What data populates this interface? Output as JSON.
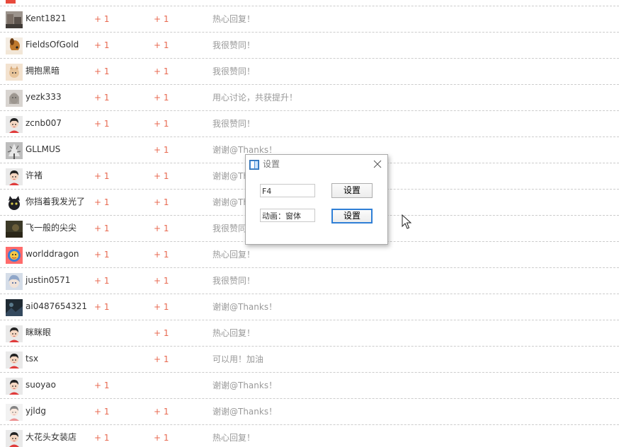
{
  "rows": [
    {
      "username": "Kent1821",
      "score1": "+ 1",
      "score2": "+ 1",
      "reason": "热心回复！",
      "avatar": "photo-avatar-gray"
    },
    {
      "username": "FieldsOfGold",
      "score1": "+ 1",
      "score2": "+ 1",
      "reason": "我很赞同！",
      "avatar": "dog-avatar"
    },
    {
      "username": "拥抱黑暗",
      "score1": "+ 1",
      "score2": "+ 1",
      "reason": "我很赞同！",
      "avatar": "cat-avatar"
    },
    {
      "username": "yezk333",
      "score1": "+ 1",
      "score2": "+ 1",
      "reason": "用心讨论，共获提升！",
      "avatar": "portrait-avatar"
    },
    {
      "username": "zcnb007",
      "score1": "+ 1",
      "score2": "+ 1",
      "reason": "我很赞同！",
      "avatar": "default-avatar"
    },
    {
      "username": "GLLMUS",
      "score1": "",
      "score2": "+ 1",
      "reason": "谢谢@Thanks！",
      "avatar": "snow-tree-avatar"
    },
    {
      "username": "许褚",
      "score1": "+ 1",
      "score2": "+ 1",
      "reason": "谢谢@Th",
      "avatar": "default-avatar"
    },
    {
      "username": "你挡着我发光了",
      "score1": "+ 1",
      "score2": "+ 1",
      "reason": "谢谢@Th",
      "avatar": "black-cat-avatar"
    },
    {
      "username": "飞一般的尖尖",
      "score1": "+ 1",
      "score2": "+ 1",
      "reason": "我很赞同",
      "avatar": "dark-photo-avatar"
    },
    {
      "username": "worlddragon",
      "score1": "+ 1",
      "score2": "+ 1",
      "reason": "热心回复！",
      "avatar": "cartoon-avatar"
    },
    {
      "username": "justin0571",
      "score1": "+ 1",
      "score2": "+ 1",
      "reason": "我很赞同！",
      "avatar": "anime-avatar"
    },
    {
      "username": "ai0487654321",
      "score1": "+ 1",
      "score2": "+ 1",
      "reason": "谢谢@Thanks！",
      "avatar": "dark-scene-avatar"
    },
    {
      "username": "眯眯眼",
      "score1": "",
      "score2": "+ 1",
      "reason": "热心回复！",
      "avatar": "default-avatar"
    },
    {
      "username": "tsx",
      "score1": "",
      "score2": "+ 1",
      "reason": "可以用！加油",
      "avatar": "default-avatar"
    },
    {
      "username": "suoyao",
      "score1": "+ 1",
      "score2": "",
      "reason": "谢谢@Thanks！",
      "avatar": "default-avatar"
    },
    {
      "username": "yjldg",
      "score1": "+ 1",
      "score2": "+ 1",
      "reason": "谢谢@Thanks！",
      "avatar": "default-avatar-faded"
    },
    {
      "username": "大花头女装店",
      "score1": "+ 1",
      "score2": "+ 1",
      "reason": "热心回复！",
      "avatar": "default-avatar"
    }
  ],
  "dialog": {
    "title": "设置",
    "field1_value": "F4",
    "field2_value": "动画：窗体",
    "button1_label": "设置",
    "button2_label": "设置",
    "app_icon": "window-app-icon",
    "close_icon": "close-icon"
  },
  "colors": {
    "score": "#e86950",
    "reason": "#999999",
    "username": "#333333",
    "divider": "#cccccc",
    "focus_button_border": "#2f7fd6"
  }
}
